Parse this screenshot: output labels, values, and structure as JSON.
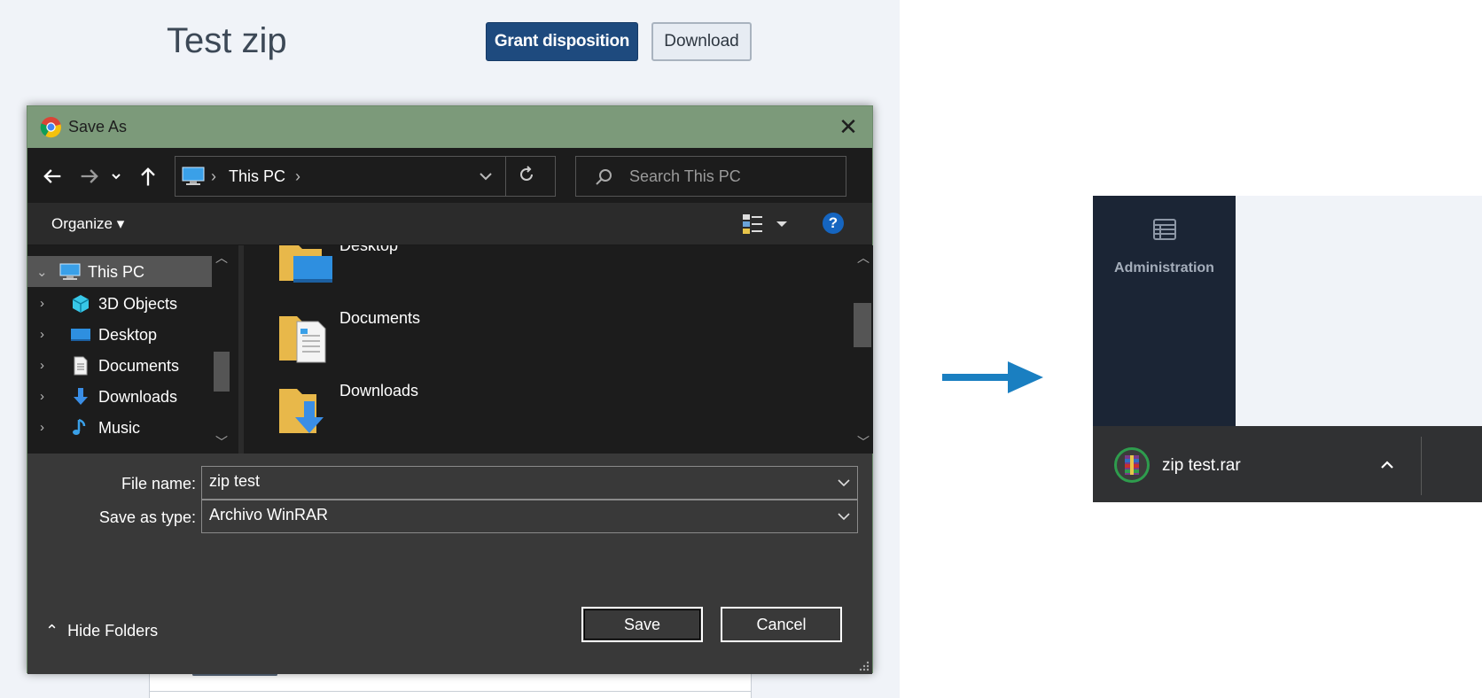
{
  "app": {
    "page_title": "Test zip",
    "grant_label": "Grant disposition",
    "download_label": "Download"
  },
  "dialog": {
    "title": "Save As",
    "close_glyph": "✕",
    "address": {
      "path_label": "This PC",
      "sep": "›"
    },
    "search": {
      "placeholder": "Search This PC"
    },
    "toolbar": {
      "organize_label": "Organize ▾",
      "help_glyph": "?"
    },
    "nav_items": [
      {
        "label": "This PC",
        "icon": "computer-icon",
        "expanded": true,
        "selected": true
      },
      {
        "label": "3D Objects",
        "icon": "cube-icon"
      },
      {
        "label": "Desktop",
        "icon": "desktop-icon"
      },
      {
        "label": "Documents",
        "icon": "document-icon"
      },
      {
        "label": "Downloads",
        "icon": "download-arrow-icon"
      },
      {
        "label": "Music",
        "icon": "music-note-icon"
      }
    ],
    "files": [
      {
        "label": "Desktop",
        "icon": "desktop-folder-icon"
      },
      {
        "label": "Documents",
        "icon": "documents-folder-icon"
      },
      {
        "label": "Downloads",
        "icon": "downloads-folder-icon"
      }
    ],
    "file_name": {
      "label": "File name:",
      "value": "zip test"
    },
    "save_type": {
      "label": "Save as type:",
      "value": "Archivo WinRAR"
    },
    "hide_folders_label": "Hide Folders",
    "save_label": "Save",
    "cancel_label": "Cancel"
  },
  "result": {
    "admin_label": "Administration",
    "download_file": "zip test.rar"
  },
  "colors": {
    "dialog_titlebar": "#7c9a7a",
    "grant_button": "#1e4a7e",
    "arrow": "#1a7fc1",
    "sidebar": "#1b2535"
  }
}
